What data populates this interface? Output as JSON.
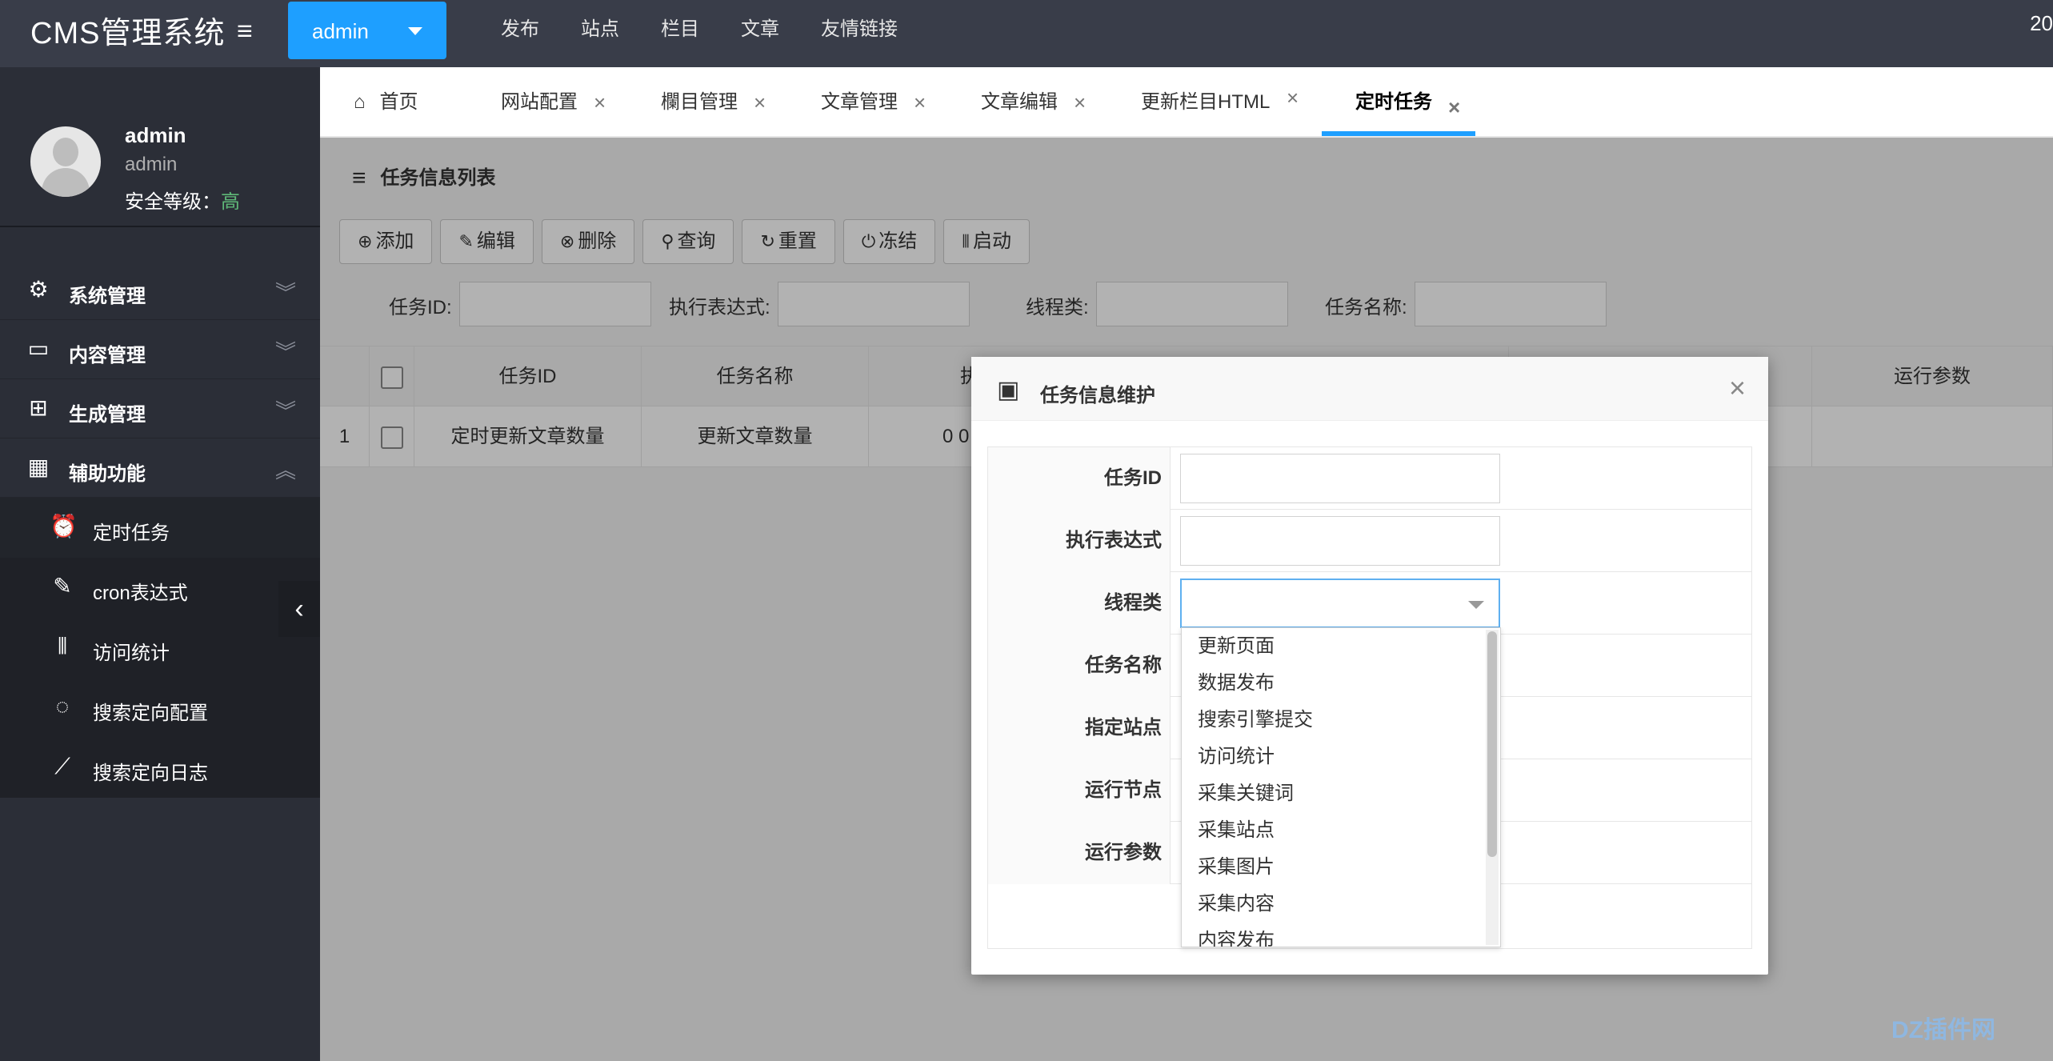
{
  "app": {
    "brand": "CMS管理系统",
    "user_dropdown": "admin",
    "top_nav": [
      "发布",
      "站点",
      "栏目",
      "文章",
      "友情链接"
    ],
    "clock_fragment": "20"
  },
  "profile": {
    "name": "admin",
    "role": "admin",
    "security_label": "安全等级：",
    "security_value": "高"
  },
  "sidebar": {
    "groups": [
      {
        "label": "系统管理",
        "icon": "gear-icon"
      },
      {
        "label": "内容管理",
        "icon": "monitor-icon"
      },
      {
        "label": "生成管理",
        "icon": "bookmark-icon"
      },
      {
        "label": "辅助功能",
        "icon": "apps-icon"
      }
    ],
    "sub_items": [
      {
        "label": "定时任务",
        "icon": "alarm-clock-icon",
        "active": true
      },
      {
        "label": "cron表达式",
        "icon": "pencil-icon"
      },
      {
        "label": "访问统计",
        "icon": "audio-bars-icon"
      },
      {
        "label": "搜索定向配置",
        "icon": "circle-loading-icon"
      },
      {
        "label": "搜索定向日志",
        "icon": "line-chart-icon"
      }
    ]
  },
  "tabs": [
    {
      "label": "首页",
      "closable": false
    },
    {
      "label": "网站配置",
      "closable": true
    },
    {
      "label": "欄目管理",
      "closable": true
    },
    {
      "label": "文章管理",
      "closable": true
    },
    {
      "label": "文章编辑",
      "closable": true
    },
    {
      "label": "更新栏目HTML",
      "closable": true
    },
    {
      "label": "定时任务",
      "closable": true,
      "active": true
    }
  ],
  "panel": {
    "title": "任务信息列表",
    "buttons": [
      {
        "label": "添加",
        "icon": "plus-circle-icon"
      },
      {
        "label": "编辑",
        "icon": "edit-icon"
      },
      {
        "label": "删除",
        "icon": "close-circle-icon"
      },
      {
        "label": "查询",
        "icon": "search-icon"
      },
      {
        "label": "重置",
        "icon": "refresh-icon"
      },
      {
        "label": "冻结",
        "icon": "power-icon"
      },
      {
        "label": "启动",
        "icon": "audio-bars-icon"
      }
    ],
    "filters": [
      {
        "label": "任务ID:",
        "value": ""
      },
      {
        "label": "执行表达式:",
        "value": ""
      },
      {
        "label": "线程类:",
        "value": ""
      },
      {
        "label": "任务名称:",
        "value": ""
      }
    ]
  },
  "table": {
    "columns": [
      "任务ID",
      "任务名称",
      "执",
      "运行参数"
    ],
    "rows": [
      {
        "index": "1",
        "task_id": "定时更新文章数量",
        "task_name": "更新文章数量",
        "expr": "0 0"
      }
    ]
  },
  "modal": {
    "title": "任务信息维护",
    "fields": [
      {
        "label": "任务ID",
        "value": ""
      },
      {
        "label": "执行表达式",
        "value": ""
      },
      {
        "label": "线程类",
        "value": ""
      },
      {
        "label": "任务名称",
        "value": ""
      },
      {
        "label": "指定站点",
        "value": ""
      },
      {
        "label": "运行节点",
        "value": ""
      },
      {
        "label": "运行参数",
        "value": ""
      }
    ],
    "thread_options": [
      "更新页面",
      "数据发布",
      "搜索引擎提交",
      "访问统计",
      "采集关键词",
      "采集站点",
      "采集图片",
      "采集内容",
      "内容发布"
    ]
  },
  "watermark": "DZ插件网"
}
